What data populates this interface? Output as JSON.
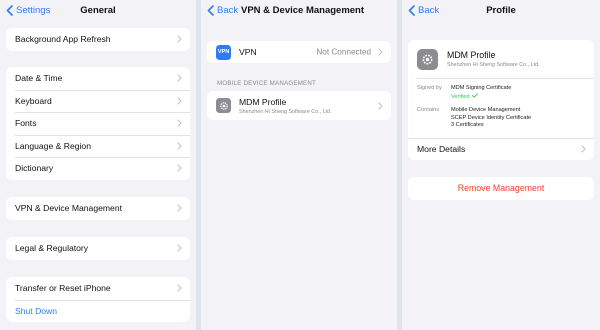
{
  "screen1": {
    "back_label": "Settings",
    "title": "General",
    "groups": [
      [
        "Background App Refresh"
      ],
      [
        "Date & Time",
        "Keyboard",
        "Fonts",
        "Language & Region",
        "Dictionary"
      ],
      [
        "VPN & Device Management"
      ],
      [
        "Legal & Regulatory"
      ],
      [
        "Transfer or Reset iPhone",
        "Shut Down"
      ]
    ]
  },
  "screen2": {
    "back_label": "Back",
    "title": "VPN & Device Management",
    "vpn_icon_text": "VPN",
    "vpn_label": "VPN",
    "vpn_status": "Not Connected",
    "section_header": "MOBILE DEVICE MANAGEMENT",
    "mdm_label": "MDM Profile",
    "mdm_sub": "Shenzhen Hi Sheng Software Co., Ltd."
  },
  "screen3": {
    "back_label": "Back",
    "title": "Profile",
    "profile_name": "MDM Profile",
    "profile_sub": "Shenzhen Hi Sheng Software Co., Ltd.",
    "signed_by_label": "Signed by",
    "signed_by_value": "MDM Signing Certificate",
    "verified_label": "Verified",
    "contains_label": "Contains",
    "contains_items": [
      "Mobile Device Management",
      "SCEP Device Identity Certificate",
      "3 Certificates"
    ],
    "more_details": "More Details",
    "remove_label": "Remove Management"
  },
  "colors": {
    "accent_blue": "#2f7cf6",
    "destructive_red": "#ff3b30",
    "verified_green": "#34c759",
    "background": "#f2f2f7"
  },
  "icons": [
    "chevron-left-icon",
    "chevron-right-icon",
    "vpn-icon",
    "gear-icon",
    "checkmark-icon"
  ]
}
